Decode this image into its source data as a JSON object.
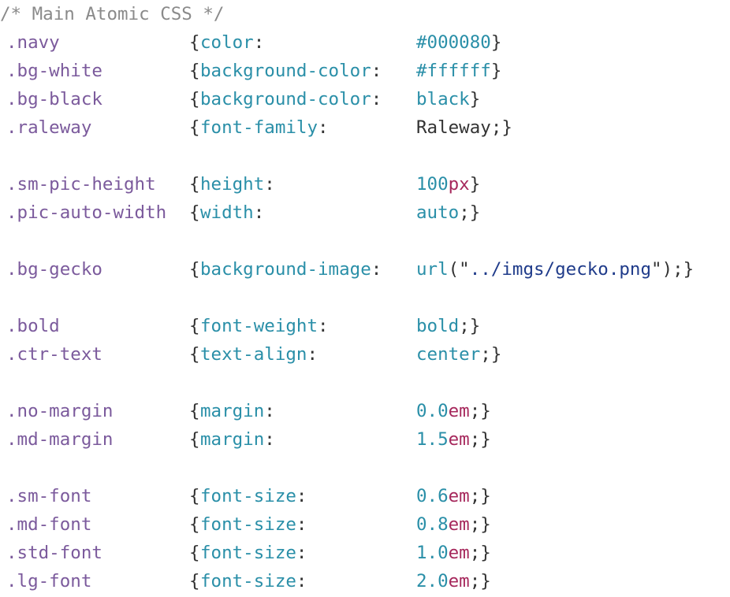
{
  "editor": {
    "comment": "/* Main Atomic CSS */",
    "rules": [
      {
        "line": 1,
        "selector": ".navy",
        "property": "color",
        "value": {
          "type": "hex",
          "text": "#000080",
          "suffix": "}"
        }
      },
      {
        "line": 2,
        "selector": ".bg-white",
        "property": "background-color",
        "value": {
          "type": "hex",
          "text": "#ffffff",
          "suffix": "}"
        }
      },
      {
        "line": 3,
        "selector": ".bg-black",
        "property": "background-color",
        "value": {
          "type": "kw",
          "text": "black",
          "suffix": "}"
        }
      },
      {
        "line": 4,
        "selector": ".raleway",
        "property": "font-family",
        "value": {
          "type": "plain",
          "text": "Raleway;",
          "suffix": "}"
        }
      },
      {
        "line": 6,
        "selector": ".sm-pic-height",
        "property": "height",
        "value": {
          "type": "num",
          "num": "100",
          "unit": "px",
          "suffix": "}"
        }
      },
      {
        "line": 7,
        "selector": ".pic-auto-width",
        "property": "width",
        "value": {
          "type": "kw",
          "text": "auto",
          "suffix": ";}"
        }
      },
      {
        "line": 9,
        "selector": ".bg-gecko",
        "property": "background-image",
        "value": {
          "type": "url",
          "fn": "url",
          "open": "(\"",
          "str": "../imgs/gecko.png",
          "close": "\");}"
        }
      },
      {
        "line": 11,
        "selector": ".bold",
        "property": "font-weight",
        "value": {
          "type": "kw",
          "text": "bold",
          "suffix": ";}"
        }
      },
      {
        "line": 12,
        "selector": ".ctr-text",
        "property": "text-align",
        "value": {
          "type": "kw",
          "text": "center",
          "suffix": ";}"
        }
      },
      {
        "line": 14,
        "selector": ".no-margin",
        "property": "margin",
        "value": {
          "type": "num",
          "num": "0.0",
          "unit": "em",
          "suffix": ";}"
        }
      },
      {
        "line": 15,
        "selector": ".md-margin",
        "property": "margin",
        "value": {
          "type": "num",
          "num": "1.5",
          "unit": "em",
          "suffix": ";}"
        }
      },
      {
        "line": 17,
        "selector": ".sm-font",
        "property": "font-size",
        "value": {
          "type": "num",
          "num": "0.6",
          "unit": "em",
          "suffix": ";}"
        }
      },
      {
        "line": 18,
        "selector": ".md-font",
        "property": "font-size",
        "value": {
          "type": "num",
          "num": "0.8",
          "unit": "em",
          "suffix": ";}"
        }
      },
      {
        "line": 19,
        "selector": ".std-font",
        "property": "font-size",
        "value": {
          "type": "num",
          "num": "1.0",
          "unit": "em",
          "suffix": ";}"
        }
      },
      {
        "line": 20,
        "selector": ".lg-font",
        "property": "font-size",
        "value": {
          "type": "num",
          "num": "2.0",
          "unit": "em",
          "suffix": ";}"
        }
      }
    ]
  }
}
